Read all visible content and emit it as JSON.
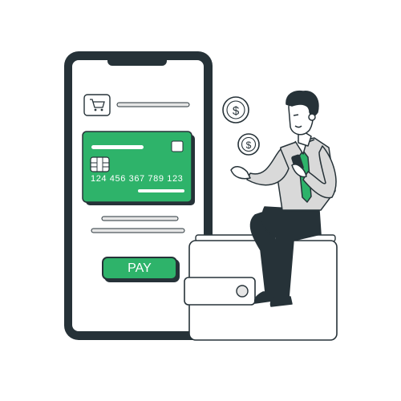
{
  "card": {
    "number": "124 456 367 789 123"
  },
  "payment": {
    "button_label": "PAY"
  },
  "coins": {
    "symbol": "$"
  },
  "colors": {
    "accent": "#2eb36a",
    "outline": "#263238",
    "light": "#f2f2f2",
    "skin": "#ffffff",
    "shirt": "#d9d9d9"
  },
  "icons": [
    "cart-icon",
    "card-chip-icon",
    "dollar-coin-icon",
    "wallet-icon",
    "smartphone-icon"
  ]
}
